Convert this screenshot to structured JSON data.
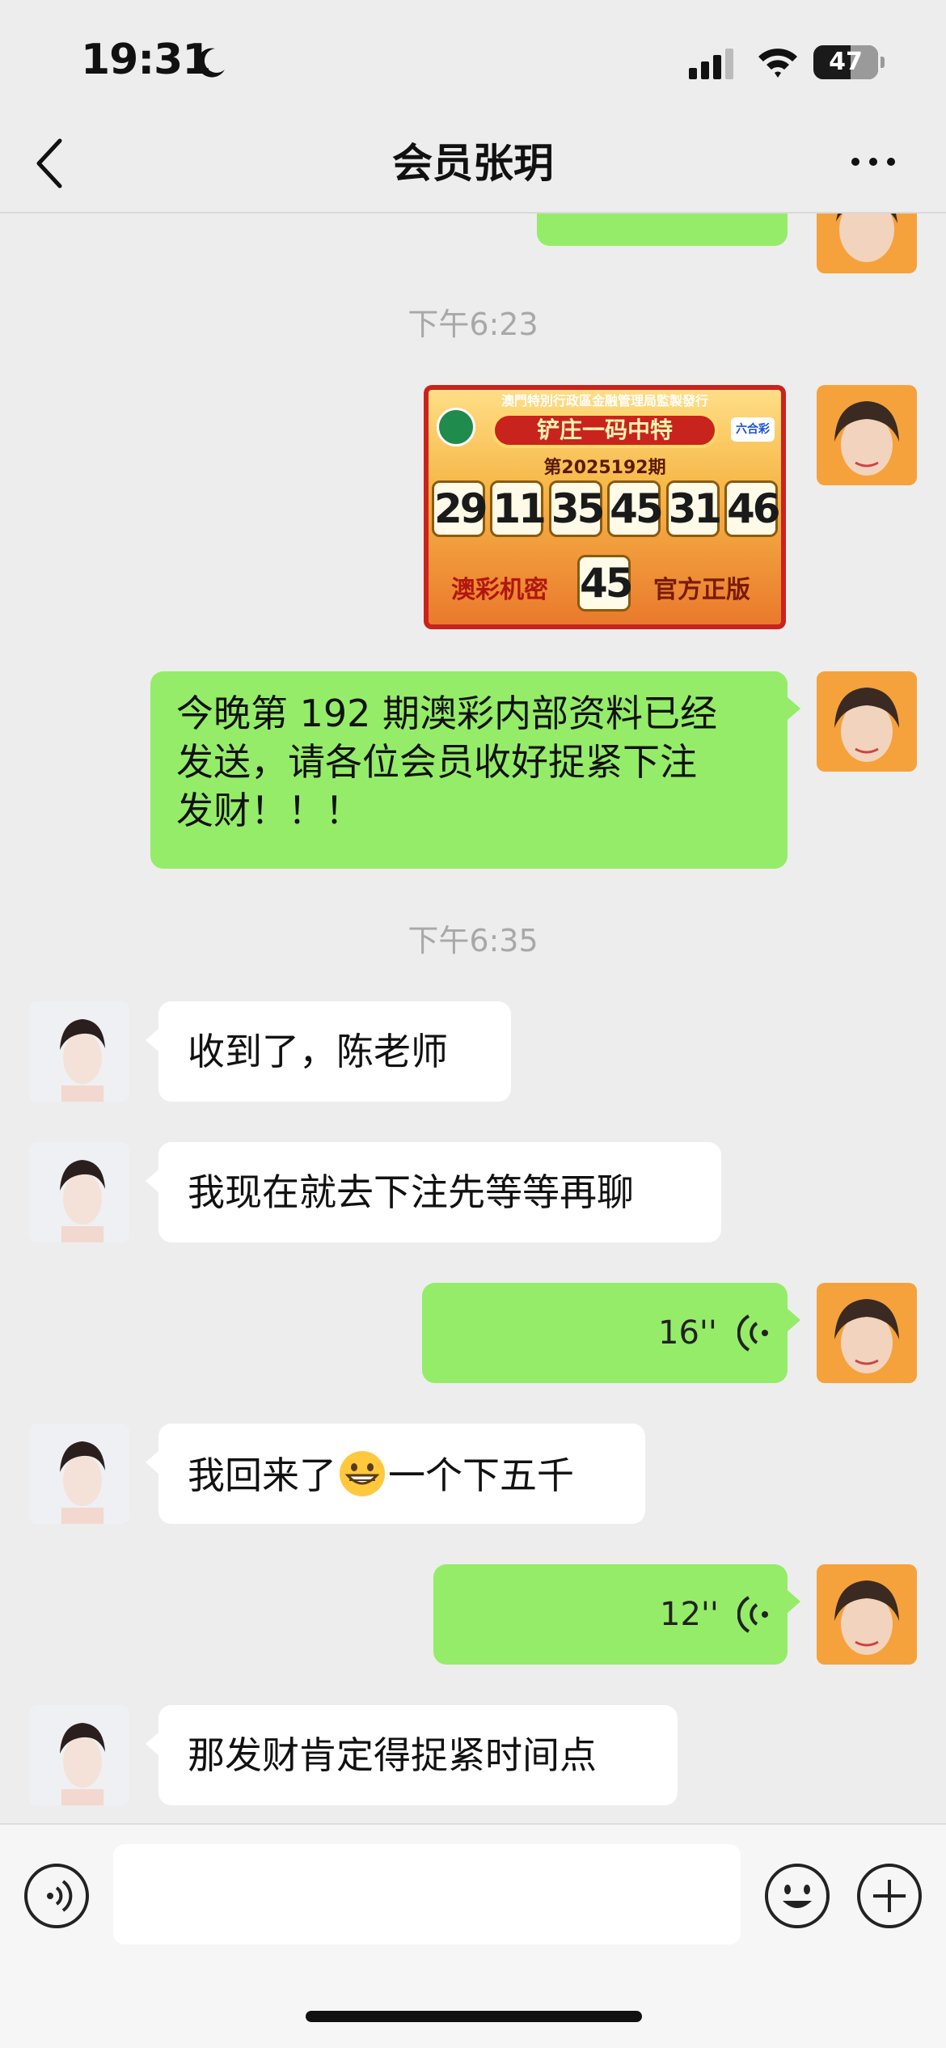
{
  "status_bar": {
    "time": "19:31",
    "battery": "47"
  },
  "header": {
    "title": "会员张玥"
  },
  "messages": {
    "ts1": "下午6:23",
    "lottery": {
      "issuer": "澳門特別行政區金融管理局監製發行",
      "banner": "铲庄一码中特",
      "issue": "第2025192期",
      "numbers": [
        "29",
        "11",
        "35",
        "45",
        "31",
        "46"
      ],
      "left_text": "澳彩机密",
      "special": "45",
      "right_text": "官方正版",
      "logo": "六合彩"
    },
    "m1": [
      "今晚第 192 期澳彩内部资料已经",
      "发送，请各位会员收好捉紧下注",
      "发财！！！"
    ],
    "ts2": "下午6:35",
    "m2": "收到了，陈老师",
    "m3": "我现在就去下注先等等再聊",
    "v1": "16''",
    "m4_a": "我回来了",
    "m4_b": "一个下五千",
    "v2": "12''",
    "m5": "那发财肯定得捉紧时间点"
  },
  "icons": {
    "back": "chevron-left-icon",
    "more": "more-dots-icon",
    "voice_input": "voice-input-icon",
    "emoji": "emoji-icon",
    "plus": "plus-icon"
  },
  "colors": {
    "background": "#ededed",
    "own_bubble": "#95ec69",
    "other_bubble": "#ffffff",
    "timestamp": "#a8a8a8"
  }
}
